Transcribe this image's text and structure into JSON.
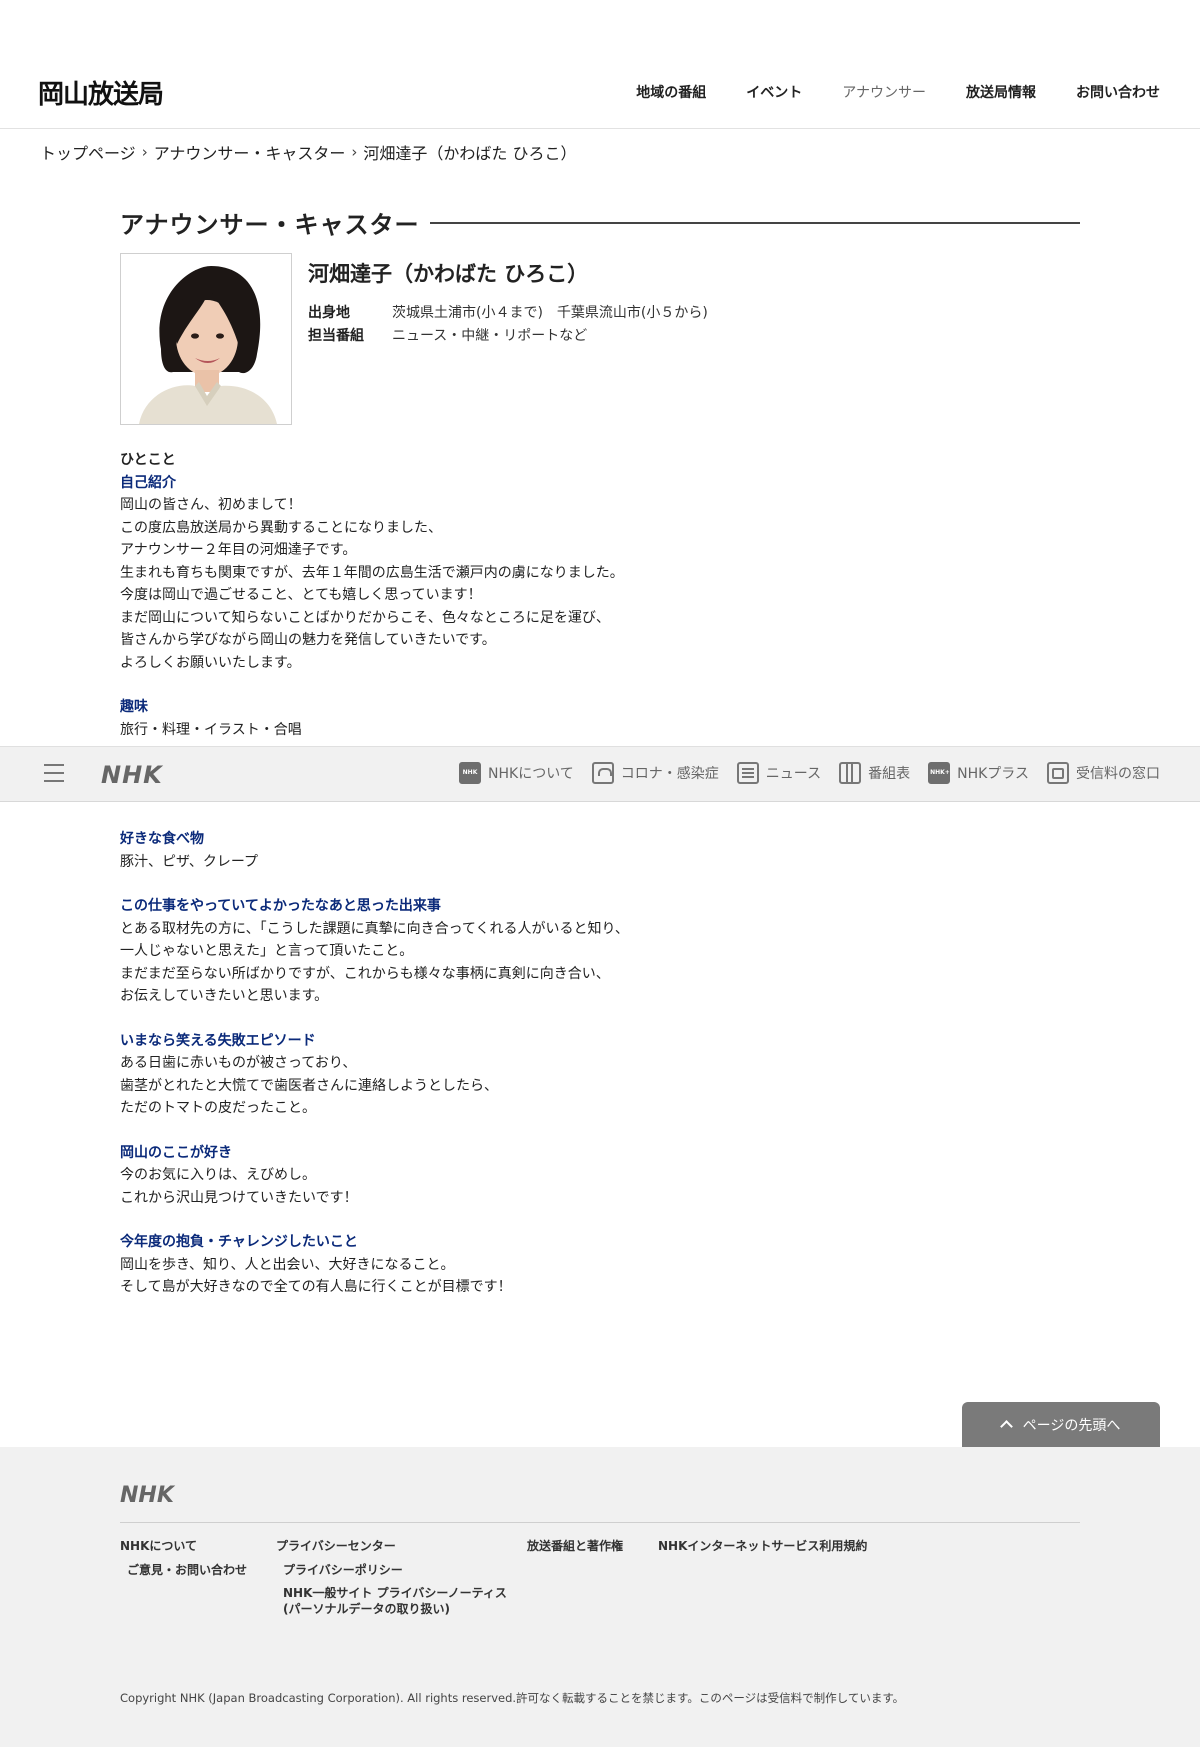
{
  "header": {
    "site_title": "岡山放送局",
    "nav": [
      {
        "label": "地域の番組",
        "current": false
      },
      {
        "label": "イベント",
        "current": false
      },
      {
        "label": "アナウンサー",
        "current": true
      },
      {
        "label": "放送局情報",
        "current": false
      },
      {
        "label": "お問い合わせ",
        "current": false
      }
    ]
  },
  "breadcrumb": [
    "トップページ",
    "アナウンサー・キャスター",
    "河畑達子（かわばた ひろこ）"
  ],
  "section_title": "アナウンサー・キャスター",
  "profile": {
    "name": "河畑達子（かわばた ひろこ）",
    "origin_label": "出身地",
    "origin": "茨城県土浦市(小４まで)　千葉県流山市(小５から)",
    "programs_label": "担当番組",
    "programs": "ニュース・中継・リポートなど"
  },
  "body": {
    "hitokoto": "ひとこと",
    "intro_head": "自己紹介",
    "intro_lines": [
      "岡山の皆さん、初めまして！",
      "この度広島放送局から異動することになりました、",
      "アナウンサー２年目の河畑達子です。",
      "生まれも育ちも関東ですが、去年１年間の広島生活で瀬戸内の虜になりました。",
      "今度は岡山で過ごせること、とても嬉しく思っています！",
      "まだ岡山について知らないことばかりだからこそ、色々なところに足を運び、",
      "皆さんから学びながら岡山の魅力を発信していきたいです。",
      "よろしくお願いいたします。"
    ],
    "hobby_head": "趣味",
    "hobby": "旅行・料理・イラスト・合唱",
    "food_head": "好きな食べ物",
    "food": "豚汁、ピザ、クレープ",
    "job_head": "この仕事をやっていてよかったなあと思った出来事",
    "job_lines": [
      "とある取材先の方に、「こうした課題に真摯に向き合ってくれる人がいると知り、",
      "一人じゃないと思えた」と言って頂いたこと。",
      "まだまだ至らない所ばかりですが、これからも様々な事柄に真剣に向き合い、",
      "お伝えしていきたいと思います。"
    ],
    "fail_head": "いまなら笑える失敗エピソード",
    "fail_lines": [
      "ある日歯に赤いものが被さっており、",
      "歯茎がとれたと大慌てで歯医者さんに連絡しようとしたら、",
      "ただのトマトの皮だったこと。"
    ],
    "like_head": "岡山のここが好き",
    "like_lines": [
      "今のお気に入りは、えびめし。",
      "これから沢山見つけていきたいです！"
    ],
    "goal_head": "今年度の抱負・チャレンジしたいこと",
    "goal_lines": [
      "岡山を歩き、知り、人と出会い、大好きになること。",
      "そして島が大好きなので全ての有人島に行くことが目標です！"
    ]
  },
  "nhk_bar": {
    "logo": "NHK",
    "links": [
      {
        "label": "NHKについて",
        "icon": "nhk-logo-icon"
      },
      {
        "label": "コロナ・感染症",
        "icon": "corona-icon"
      },
      {
        "label": "ニュース",
        "icon": "news-icon"
      },
      {
        "label": "番組表",
        "icon": "program-grid-icon"
      },
      {
        "label": "NHKプラス",
        "icon": "nhk-plus-icon"
      },
      {
        "label": "受信料の窓口",
        "icon": "reception-fee-icon"
      }
    ]
  },
  "to_top": "ページの先頭へ",
  "footer": {
    "logo": "NHK",
    "col1_head": "NHKについて",
    "col1_items": [
      "ご意見・お問い合わせ"
    ],
    "col2_head": "プライバシーセンター",
    "col2_items": [
      "プライバシーポリシー",
      "NHK一般サイト プライバシーノーティス",
      "(パーソナルデータの取り扱い)"
    ],
    "col3_head": "放送番組と著作権",
    "col4_head": "NHKインターネットサービス利用規約",
    "copyright": "Copyright NHK (Japan Broadcasting Corporation). All rights reserved.許可なく転載することを禁じます。このページは受信料で制作しています。"
  },
  "colors": {
    "accent_heading": "#0b2a7a",
    "footer_bg": "#f1f1f1",
    "to_top_bg": "#7a7a7a"
  }
}
